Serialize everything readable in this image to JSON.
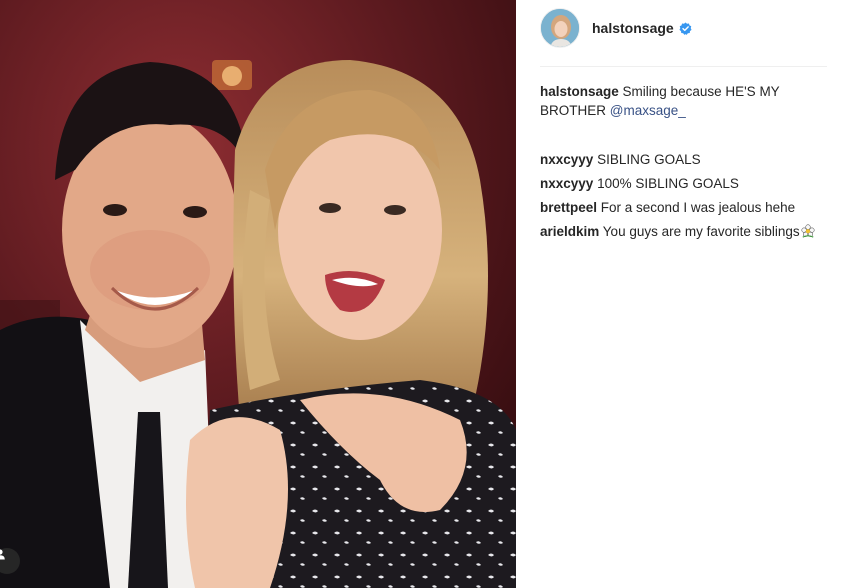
{
  "post": {
    "author": "halstonsage",
    "verified": true,
    "caption_text": "Smiling because HE'S MY BROTHER",
    "caption_mention": "@maxsage_"
  },
  "comments": [
    {
      "user": "nxxcyyy",
      "text": "SIBLING GOALS"
    },
    {
      "user": "nxxcyyy",
      "text": "100% SIBLING GOALS"
    },
    {
      "user": "brettpeel",
      "text": "For a second I was jealous hehe"
    },
    {
      "user": "arieldkim",
      "text": "You guys are my favorite siblings"
    }
  ],
  "icons": {
    "verified": "verified-badge-icon",
    "user_tag": "user-tag-icon",
    "comment_emoji": "flower-emoji-icon"
  },
  "colors": {
    "mention": "#385185",
    "verified": "#3897f0",
    "text": "#262626",
    "divider": "#efefef"
  }
}
